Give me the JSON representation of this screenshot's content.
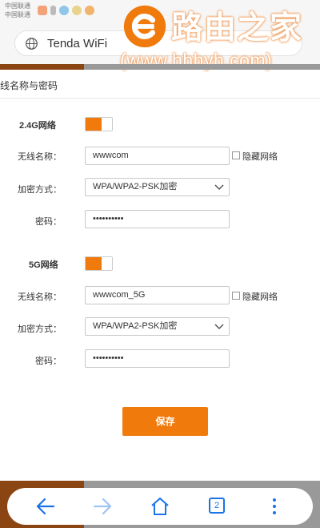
{
  "status_bar": {
    "carrier_1": "中国联通",
    "carrier_2": "中国联通"
  },
  "browser": {
    "url_title": "Tenda WiFi",
    "tab_count": "2"
  },
  "watermark": {
    "site_name": "路由之家",
    "site_url": "(www.hhhyh.com)"
  },
  "page": {
    "section_title": "线名称与密码",
    "band_24": {
      "label": "2.4G网络",
      "enabled": true,
      "ssid_label": "无线名称：",
      "ssid_value": "wwwcom",
      "hide_label": "隐藏网络",
      "security_label": "加密方式：",
      "security_value": "WPA/WPA2-PSK加密",
      "password_label": "密码：",
      "password_value": "••••••••••"
    },
    "band_5": {
      "label": "5G网络",
      "enabled": true,
      "ssid_label": "无线名称：",
      "ssid_value": "wwwcom_5G",
      "hide_label": "隐藏网络",
      "security_label": "加密方式：",
      "security_value": "WPA/WPA2-PSK加密",
      "password_label": "密码：",
      "password_value": "••••••••••"
    },
    "save_label": "保存"
  },
  "colors": {
    "accent": "#f07a0c",
    "nav_blue": "#1a73e8",
    "brown": "#8b4513"
  }
}
